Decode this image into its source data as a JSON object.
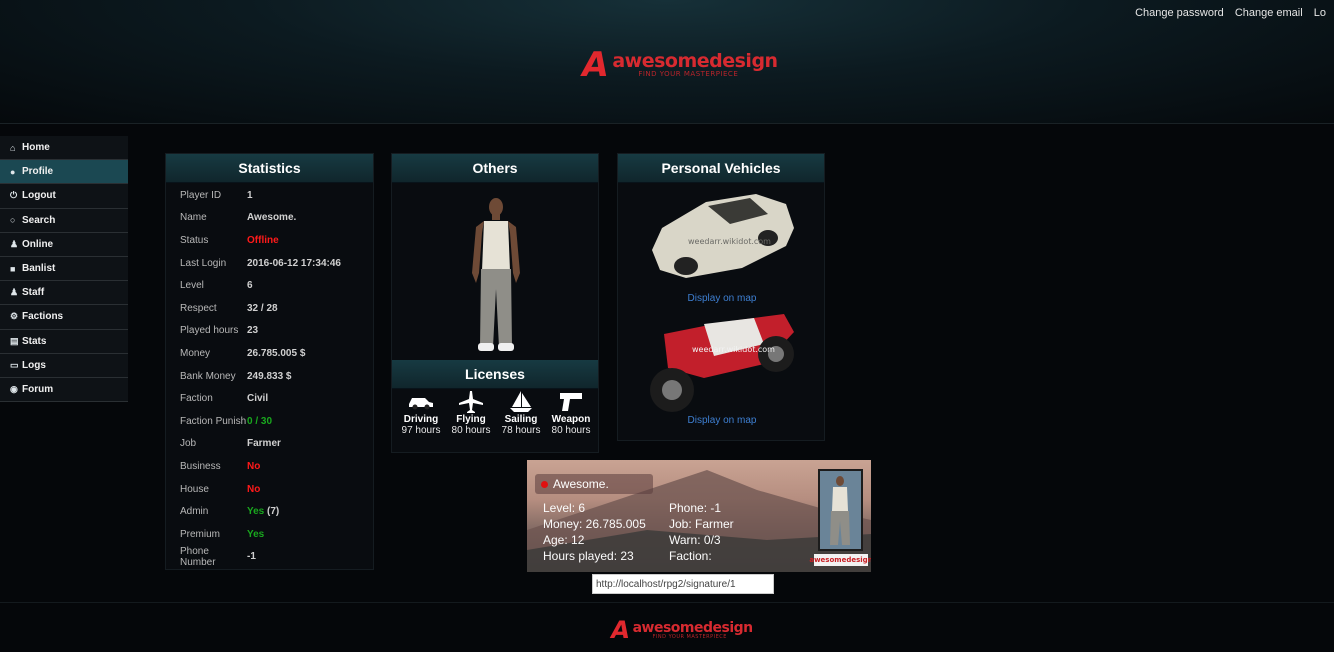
{
  "header": {
    "links": [
      "Change password",
      "Change email",
      "Lo"
    ],
    "logo": {
      "mark": "A",
      "brand": "awesomedesign",
      "tagline": "FIND YOUR MASTERPIECE"
    }
  },
  "sidebar": {
    "items": [
      {
        "label": "Home",
        "icon": "home-icon"
      },
      {
        "label": "Profile",
        "icon": "user-icon",
        "active": true
      },
      {
        "label": "Logout",
        "icon": "power-icon"
      },
      {
        "label": "Search",
        "icon": "search-icon"
      },
      {
        "label": "Online",
        "icon": "users-icon"
      },
      {
        "label": "Banlist",
        "icon": "ban-icon"
      },
      {
        "label": "Staff",
        "icon": "users-icon"
      },
      {
        "label": "Factions",
        "icon": "gears-icon"
      },
      {
        "label": "Stats",
        "icon": "stats-icon"
      },
      {
        "label": "Logs",
        "icon": "book-icon"
      },
      {
        "label": "Forum",
        "icon": "comments-icon"
      }
    ]
  },
  "statistics": {
    "title": "Statistics",
    "rows": [
      {
        "key": "Player ID",
        "value": "1"
      },
      {
        "key": "Name",
        "value": "Awesome."
      },
      {
        "key": "Status",
        "value": "Offline",
        "color": "red"
      },
      {
        "key": "Last Login",
        "value": "2016-06-12 17:34:46"
      },
      {
        "key": "Level",
        "value": "6"
      },
      {
        "key": "Respect",
        "value": "32 / 28"
      },
      {
        "key": "Played hours",
        "value": "23"
      },
      {
        "key": "Money",
        "value": "26.785.005 $"
      },
      {
        "key": "Bank Money",
        "value": "249.833 $"
      },
      {
        "key": "Faction",
        "value": "Civil"
      },
      {
        "key": "Faction Punish",
        "value": "0 / 30",
        "color": "green"
      },
      {
        "key": "Job",
        "value": "Farmer"
      },
      {
        "key": "Business",
        "value": "No",
        "color": "red"
      },
      {
        "key": "House",
        "value": "No",
        "color": "red"
      },
      {
        "key": "Admin",
        "value": "Yes",
        "color": "green",
        "suffix": " (7)"
      },
      {
        "key": "Premium",
        "value": "Yes",
        "color": "green"
      },
      {
        "key": "Phone Number",
        "value": "-1"
      }
    ]
  },
  "others": {
    "title": "Others"
  },
  "licenses": {
    "title": "Licenses",
    "items": [
      {
        "name": "Driving",
        "hours": "97 hours",
        "icon": "car-icon"
      },
      {
        "name": "Flying",
        "hours": "80 hours",
        "icon": "plane-icon"
      },
      {
        "name": "Sailing",
        "hours": "78 hours",
        "icon": "sailboat-icon"
      },
      {
        "name": "Weapon",
        "hours": "80 hours",
        "icon": "gun-icon"
      }
    ]
  },
  "vehicles": {
    "title": "Personal Vehicles",
    "items": [
      {
        "watermark": "weedarr.wikidot.com",
        "link": "Display on map"
      },
      {
        "watermark": "weedarr.wikidot.com",
        "link": "Display on map"
      }
    ]
  },
  "signature": {
    "name": "Awesome.",
    "left": [
      "Level: 6",
      "Money: 26.785.005",
      "Age: 12",
      "Hours played: 23"
    ],
    "right": [
      "Phone: -1",
      "Job: Farmer",
      "Warn: 0/3",
      "Faction:"
    ],
    "logo": "awesomedesign"
  },
  "url": "http://localhost/rpg2/signature/1",
  "colors": {
    "accent": "#1b4852",
    "brand": "#d72a30",
    "offline": "#ff1a1a",
    "yes": "#19a81e",
    "link": "#3e7fd1"
  }
}
